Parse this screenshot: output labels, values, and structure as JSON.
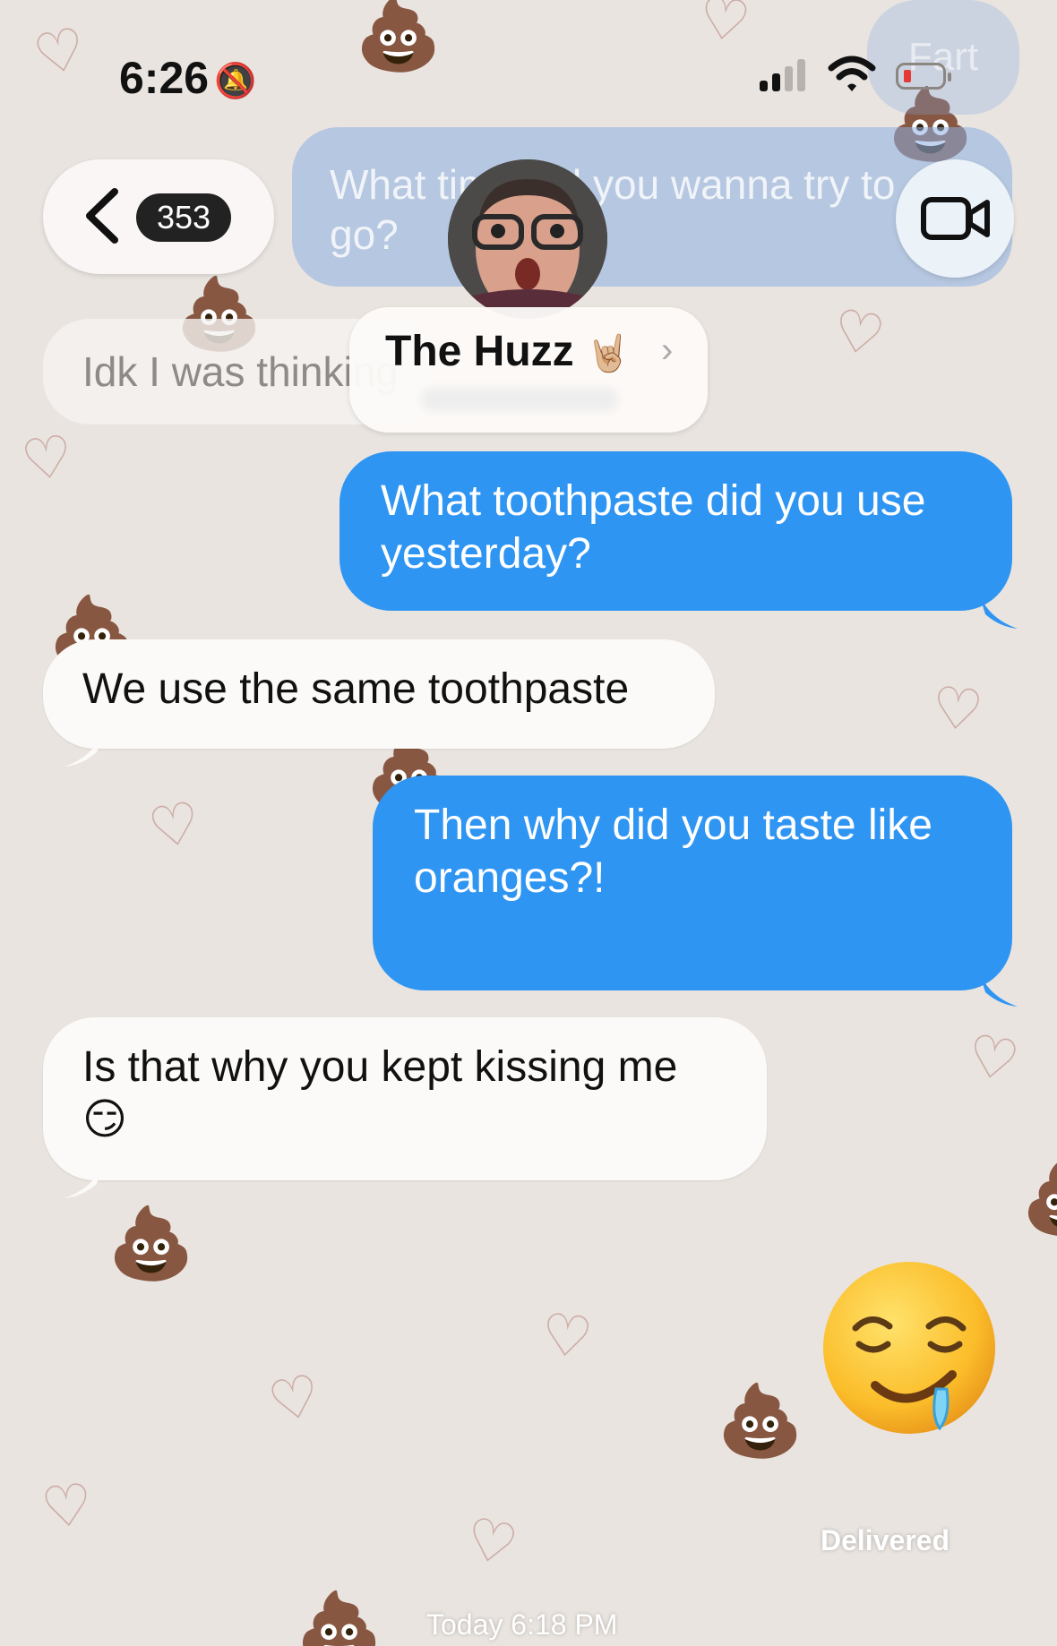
{
  "status_bar": {
    "time": "6:26",
    "silent_icon": "bell-slash-icon",
    "signal_bars": 2,
    "battery_level": "low"
  },
  "faded_messages": {
    "top_right": "Fart",
    "outgoing": "What time did you wanna try to go?",
    "incoming": "Idk I was thinking"
  },
  "header": {
    "back_icon": "chevron-left-icon",
    "unread_count": "353",
    "contact_name": "The Huzz",
    "contact_emoji": "🤘🏼",
    "video_icon": "video-camera-icon"
  },
  "messages": [
    {
      "direction": "outgoing",
      "text": "What toothpaste did you use yesterday?"
    },
    {
      "direction": "incoming",
      "text": "We use the same toothpaste"
    },
    {
      "direction": "outgoing",
      "text": "Then why did you taste like oranges?!"
    },
    {
      "direction": "incoming",
      "text": "Is that why you kept kissing me",
      "emoji": "😏"
    },
    {
      "direction": "outgoing",
      "emoji": "🤤",
      "status": "Delivered"
    }
  ],
  "timestamp": "Today 6:18 PM",
  "colors": {
    "outgoing_bubble": "#2f95f2",
    "incoming_bubble": "#fbfaf8",
    "wallpaper": "#e9e4df",
    "heart": "#c49a94"
  }
}
